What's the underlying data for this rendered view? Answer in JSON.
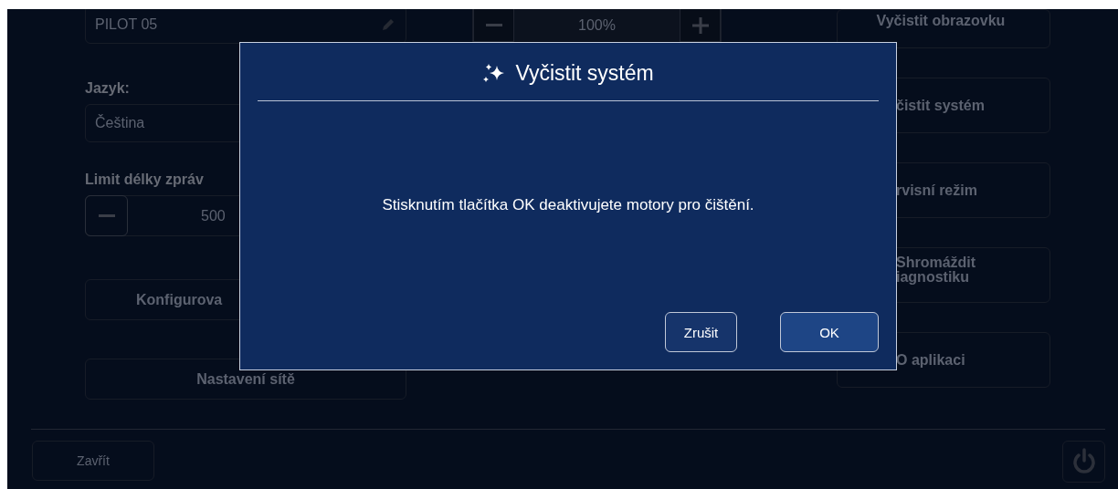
{
  "settings": {
    "name_field": {
      "value": "PILOT 05"
    },
    "language": {
      "label": "Jazyk:",
      "value": "Čeština"
    },
    "message_limit": {
      "label": "Limit délky zpráv",
      "value": "500"
    },
    "buttons": [
      "Konfigurova",
      "Nastavení sítě"
    ]
  },
  "zoom": {
    "value": "100%"
  },
  "actions": [
    {
      "lines": [
        "Vyčistit obrazovku"
      ]
    },
    {
      "lines": [
        "čistit systém"
      ]
    },
    {
      "lines": [
        "rvisní režim"
      ]
    },
    {
      "lines": [
        "Shromáždit",
        "iagnostiku"
      ]
    },
    {
      "lines": [
        "O aplikaci"
      ]
    }
  ],
  "footer": {
    "close": "Zavřít"
  },
  "dialog": {
    "title": "Vyčistit systém",
    "message": "Stisknutím tlačítka OK deaktivujete motory pro čištění.",
    "buttons": [
      {
        "label": "Zrušit",
        "kind": "secondary"
      },
      {
        "label": "OK",
        "kind": "primary"
      }
    ]
  }
}
